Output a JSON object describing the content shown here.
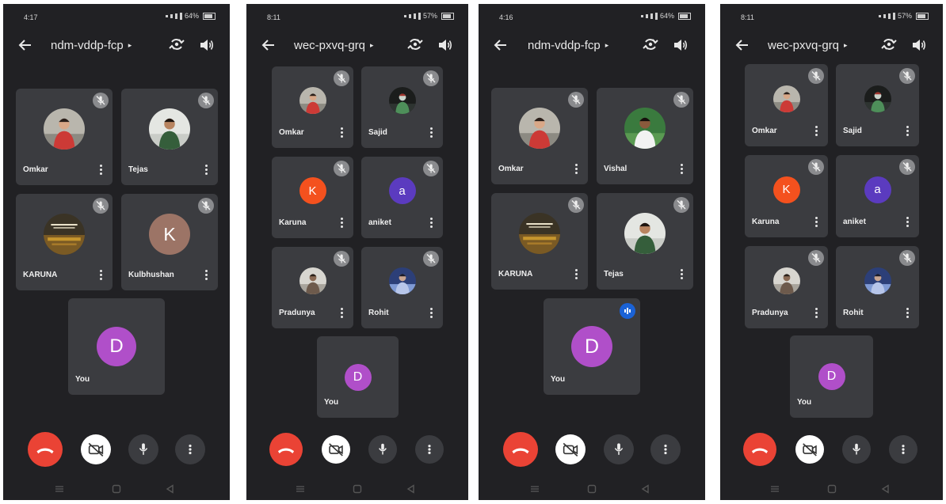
{
  "colors": {
    "phone_bg": "#212124",
    "tile_bg": "#3b3c40",
    "end_call": "#ea4335",
    "active_control": "#ffffff",
    "control_bg": "#3b3c40",
    "avatar_purple": "#b04fc9",
    "avatar_orange": "#f4511e",
    "avatar_indigo": "#5b3bbf",
    "avatar_brown": "#9c7466",
    "speaking_indicator": "#1a62d6"
  },
  "screens": [
    {
      "status_time": "4:17",
      "status_battery": "64%",
      "meeting_code": "ndm-vddp-fcp",
      "tiles": [
        {
          "name": "Omkar",
          "avatar": "photo-person-red",
          "muted": true
        },
        {
          "name": "Tejas",
          "avatar": "photo-person-green",
          "muted": true
        },
        {
          "name": "KARUNA",
          "avatar": "photo-poster",
          "muted": true
        },
        {
          "name": "Kulbhushan",
          "avatar_letter": "K",
          "avatar_color": "#9c7466",
          "muted": true
        }
      ],
      "self_tile": {
        "name": "You",
        "avatar_letter": "D",
        "avatar_color": "#b04fc9"
      }
    },
    {
      "status_time": "8:11",
      "status_battery": "57%",
      "meeting_code": "wec-pxvq-grq",
      "tiles": [
        {
          "name": "Omkar",
          "avatar": "photo-person-red",
          "muted": true
        },
        {
          "name": "Sajid",
          "avatar": "photo-dark",
          "muted": true
        },
        {
          "name": "Karuna",
          "avatar_letter": "K",
          "avatar_color": "#f4511e",
          "muted": true
        },
        {
          "name": "aniket",
          "avatar_letter": "a",
          "avatar_color": "#5b3bbf",
          "muted": true
        },
        {
          "name": "Pradunya",
          "avatar": "photo-person-light",
          "muted": true
        },
        {
          "name": "Rohit",
          "avatar": "photo-person-blue",
          "muted": true
        }
      ],
      "self_tile": {
        "name": "You",
        "avatar_letter": "D",
        "avatar_color": "#b04fc9"
      }
    },
    {
      "status_time": "4:16",
      "status_battery": "64%",
      "meeting_code": "ndm-vddp-fcp",
      "tiles": [
        {
          "name": "Omkar",
          "avatar": "photo-person-red",
          "muted": true
        },
        {
          "name": "Vishal",
          "avatar": "photo-person-white",
          "muted": true
        },
        {
          "name": "KARUNA",
          "avatar": "photo-poster",
          "muted": true
        },
        {
          "name": "Tejas",
          "avatar": "photo-person-green",
          "muted": true
        }
      ],
      "self_tile": {
        "name": "You",
        "avatar_letter": "D",
        "avatar_color": "#b04fc9",
        "speaking": true
      }
    },
    {
      "status_time": "8:11",
      "status_battery": "57%",
      "meeting_code": "wec-pxvq-grq",
      "tiles": [
        {
          "name": "Omkar",
          "avatar": "photo-person-red",
          "muted": true
        },
        {
          "name": "Sajid",
          "avatar": "photo-dark",
          "muted": true
        },
        {
          "name": "Karuna",
          "avatar_letter": "K",
          "avatar_color": "#f4511e",
          "muted": true
        },
        {
          "name": "aniket",
          "avatar_letter": "a",
          "avatar_color": "#5b3bbf",
          "muted": true
        },
        {
          "name": "Pradunya",
          "avatar": "photo-person-light",
          "muted": true
        },
        {
          "name": "Rohit",
          "avatar": "photo-person-blue",
          "muted": true
        }
      ],
      "self_tile": {
        "name": "You",
        "avatar_letter": "D",
        "avatar_color": "#b04fc9"
      }
    }
  ],
  "controls": [
    "end-call",
    "camera-off",
    "microphone",
    "more-options"
  ],
  "icons": [
    "back-arrow-icon",
    "switch-camera-icon",
    "speaker-icon",
    "mic-off-icon",
    "more-vertical-icon",
    "end-call-icon",
    "camera-off-icon",
    "microphone-icon",
    "nav-recents-icon",
    "nav-home-icon",
    "nav-back-icon"
  ]
}
